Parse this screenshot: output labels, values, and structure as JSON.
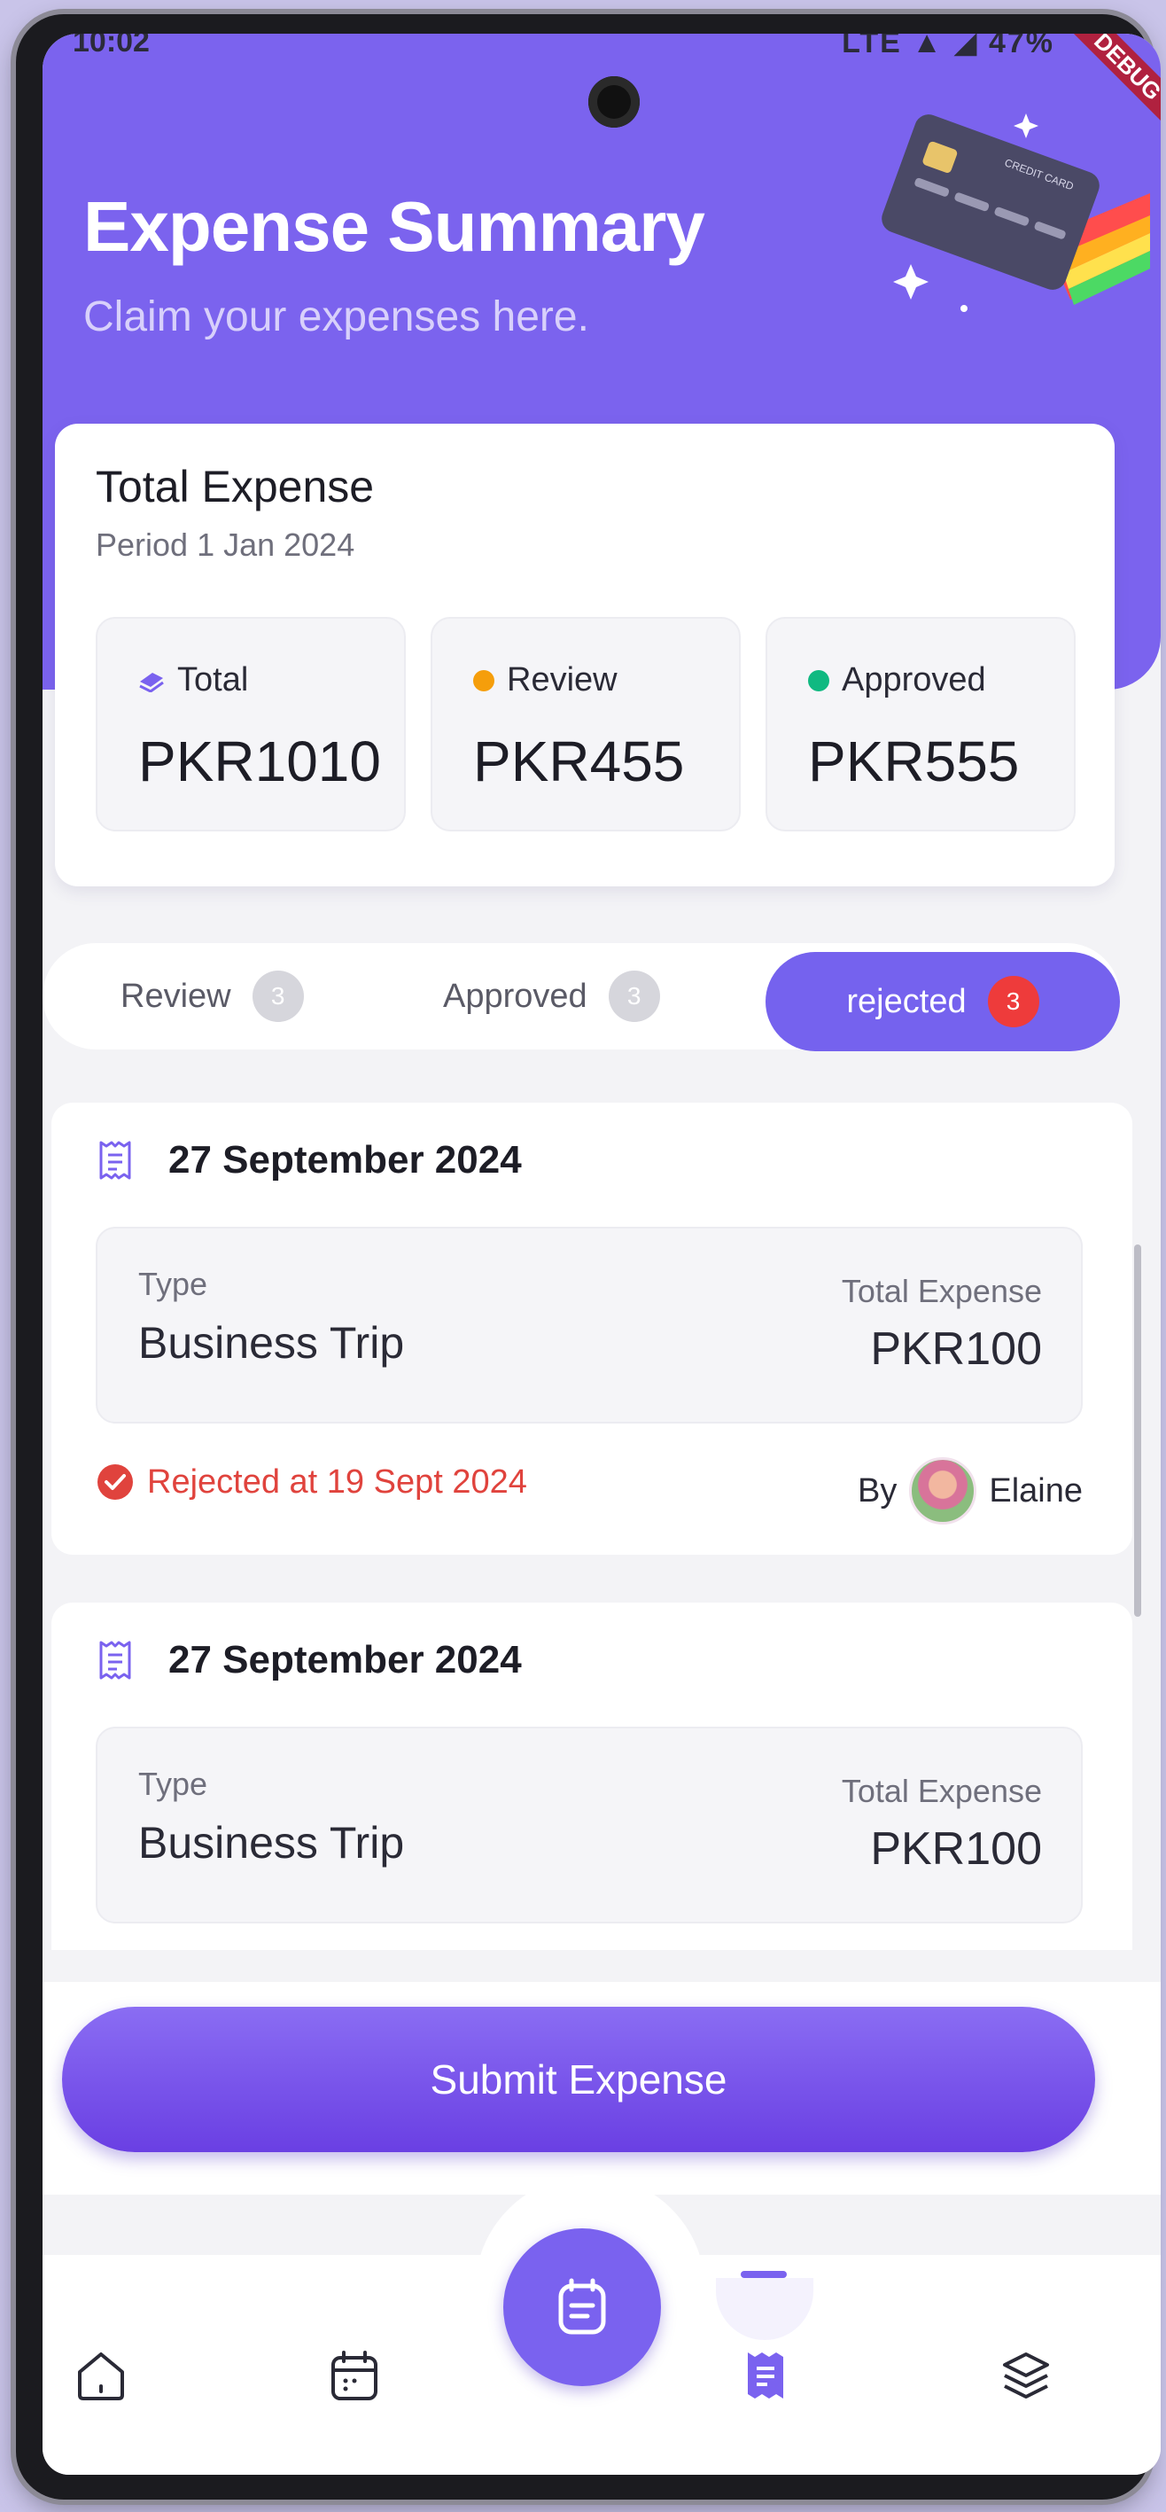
{
  "status_bar": {
    "time": "10:02",
    "right": "LTE ▲ ◢ 47%"
  },
  "debug_badge": "DEBUG",
  "header": {
    "title": "Expense Summary",
    "subtitle": "Claim your expenses here.",
    "illustration_text": "CREDIT CARD"
  },
  "summary": {
    "title": "Total Expense",
    "period": "Period 1 Jan 2024",
    "stats": [
      {
        "label": "Total",
        "value": "PKR1010",
        "color": "#7a62ef"
      },
      {
        "label": "Review",
        "value": "PKR455",
        "color": "#f59e0b"
      },
      {
        "label": "Approved",
        "value": "PKR555",
        "color": "#10b981"
      }
    ]
  },
  "tabs": [
    {
      "label": "Review",
      "count": "3",
      "active": false
    },
    {
      "label": "Approved",
      "count": "3",
      "active": false
    },
    {
      "label": "rejected",
      "count": "3",
      "active": true
    }
  ],
  "expenses": [
    {
      "date": "27 September 2024",
      "type_label": "Type",
      "type": "Business Trip",
      "total_label": "Total Expense",
      "total": "PKR100",
      "status_text": "Rejected at 19 Sept 2024",
      "by_label": "By",
      "by_name": "Elaine"
    },
    {
      "date": "27 September 2024",
      "type_label": "Type",
      "type": "Business Trip",
      "total_label": "Total Expense",
      "total": "PKR100"
    }
  ],
  "submit_label": "Submit Expense",
  "nav": {
    "items": [
      "home-icon",
      "calendar-icon",
      "receipt-icon",
      "layers-icon"
    ],
    "active": "receipt-icon",
    "fab_icon": "document-icon"
  },
  "colors": {
    "primary": "#7a62ef",
    "rejected": "#e0433d",
    "review": "#f59e0b",
    "approved": "#10b981"
  }
}
